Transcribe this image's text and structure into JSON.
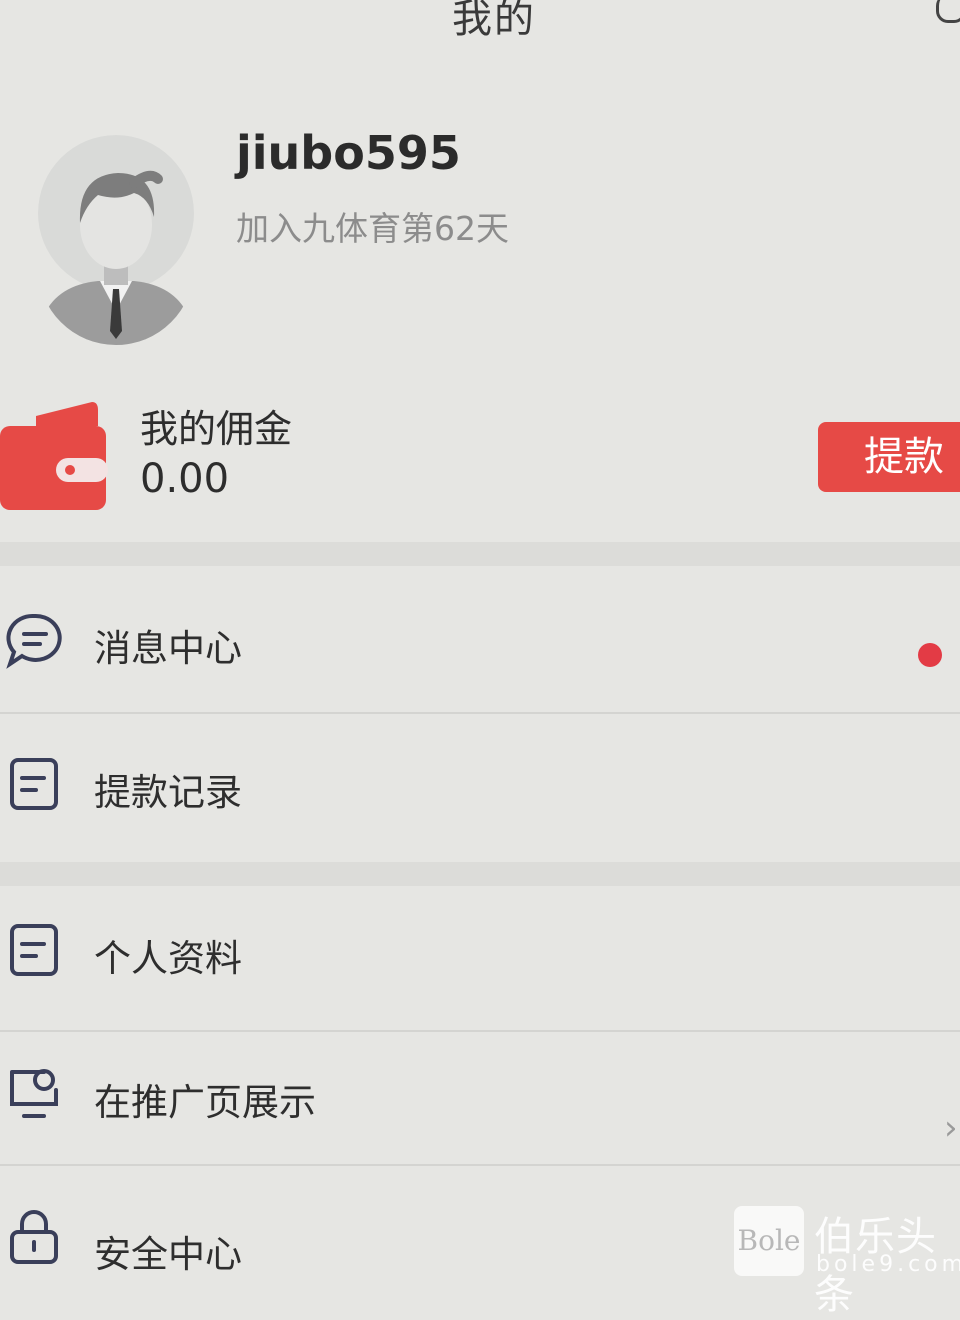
{
  "header": {
    "title": "我的"
  },
  "profile": {
    "username": "jiubo595",
    "joined_text": "加入九体育第62天"
  },
  "wallet": {
    "label": "我的佣金",
    "amount": "0.00",
    "withdraw_label": "提款",
    "accent_color": "#e64a46"
  },
  "menu": {
    "items": [
      {
        "label": "消息中心",
        "icon": "chat-bubble-icon",
        "has_badge": true
      },
      {
        "label": "提款记录",
        "icon": "document-icon"
      },
      {
        "label": "个人资料",
        "icon": "document-icon"
      },
      {
        "label": "在推广页展示",
        "icon": "display-icon"
      },
      {
        "label": "安全中心",
        "icon": "lock-icon"
      }
    ],
    "badge_color": "#e33b45"
  },
  "watermark": {
    "box_text": "Bole",
    "name": "伯乐头条",
    "url": "bole9.com"
  }
}
